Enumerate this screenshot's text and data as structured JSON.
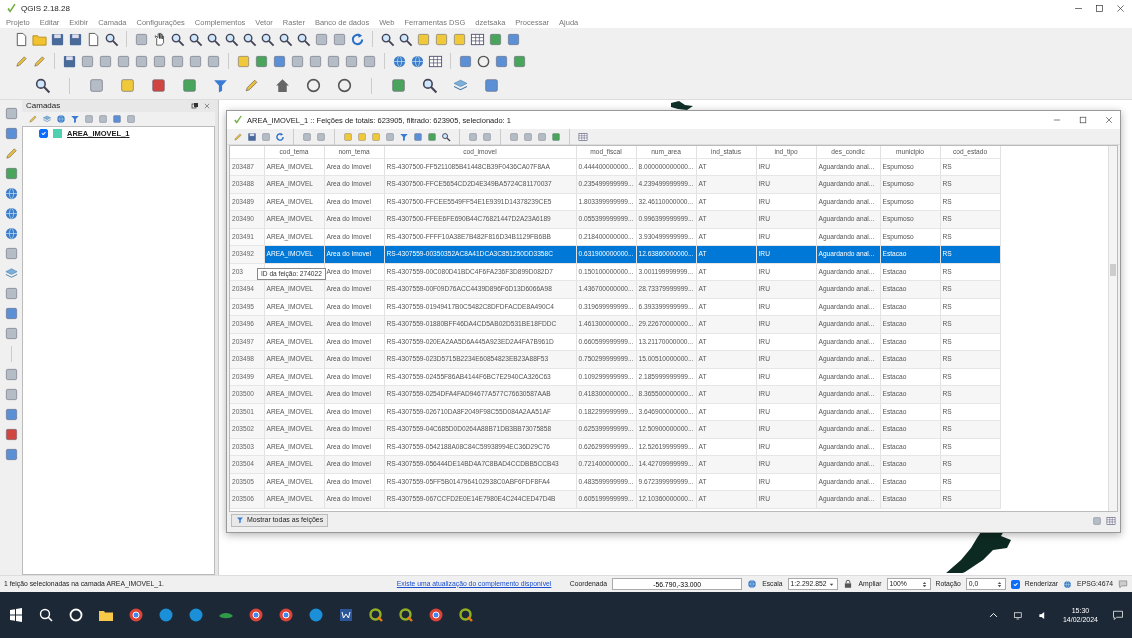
{
  "window": {
    "title": "QGIS 2.18.28"
  },
  "menu": [
    "Projeto",
    "Editar",
    "Exibir",
    "Camada",
    "Configurações",
    "Complementos",
    "Vetor",
    "Raster",
    "Banco de dados",
    "Web",
    "Ferramentas DSG",
    "dzetsaka",
    "Processar",
    "Ajuda"
  ],
  "layers_panel": {
    "title": "Camadas",
    "layers": [
      {
        "name": "AREA_IMOVEL_1",
        "checked": true
      }
    ]
  },
  "attribute_table": {
    "title": "AREA_IMOVEL_1 :: Feições de totais: 623905, filtrado: 623905, selecionado: 1",
    "columns": [
      "cod_tema",
      "nom_tema",
      "cod_imovel",
      "mod_fiscal",
      "num_area",
      "ind_status",
      "ind_tipo",
      "des_condic",
      "municipio",
      "cod_estado"
    ],
    "rows": [
      {
        "id": "203487",
        "selected": false,
        "cells": [
          "AREA_IMOVEL",
          "Area do Imovel",
          "RS-4307500-FF5211085B41448CB39F0436CA07F8AA",
          "0.444400000000...",
          "8.000000000000...",
          "AT",
          "IRU",
          "Aguardando anal...",
          "Espumoso",
          "RS"
        ]
      },
      {
        "id": "203488",
        "selected": false,
        "cells": [
          "AREA_IMOVEL",
          "Area do Imovel",
          "RS-4307500-FFCE5654CD2D4E349BA5724C81170037",
          "0.235499999999...",
          "4.239499999999...",
          "AT",
          "IRU",
          "Aguardando anal...",
          "Espumoso",
          "RS"
        ]
      },
      {
        "id": "203489",
        "selected": false,
        "cells": [
          "AREA_IMOVEL",
          "Area do Imovel",
          "RS-4307500-FFCEE5549FF54E1E9391D14378239CE5",
          "1.803399999999...",
          "32.46110000000...",
          "AT",
          "IRU",
          "Aguardando anal...",
          "Espumoso",
          "RS"
        ]
      },
      {
        "id": "203490",
        "selected": false,
        "cells": [
          "AREA_IMOVEL",
          "Area do Imovel",
          "RS-4307500-FFEE6FE690B44C76821447D2A23A6189",
          "0.055399999999...",
          "0.996399999999...",
          "AT",
          "IRU",
          "Aguardando anal...",
          "Espumoso",
          "RS"
        ]
      },
      {
        "id": "203491",
        "selected": false,
        "cells": [
          "AREA_IMOVEL",
          "Area do Imovel",
          "RS-4307500-FFFF10A38E7B482F816D34B1129FB6BB",
          "0.218400000000...",
          "3.930499999999...",
          "AT",
          "IRU",
          "Aguardando anal...",
          "Espumoso",
          "RS"
        ]
      },
      {
        "id": "203492",
        "selected": true,
        "cells": [
          "AREA_IMOVEL",
          "Area do Imovel",
          "RS-4307559-00350352AC8A41DCA3C851250DD3358C",
          "0.631900000000...",
          "12.63860000000...",
          "AT",
          "IRU",
          "Aguardando anal...",
          "Estacao",
          "RS"
        ]
      },
      {
        "id": "203",
        "selected": false,
        "cells": [
          null,
          "Area do Imovel",
          "RS-4307559-00C080D41BDC4F6FA236F3D899D082D7",
          "0.150100000000...",
          "3.001199999999...",
          "AT",
          "IRU",
          "Aguardando anal...",
          "Estacao",
          "RS"
        ]
      },
      {
        "id": "203494",
        "selected": false,
        "cells": [
          "AREA_IMOVEL",
          "Area do Imovel",
          "RS-4307559-00F09D76ACC4439D896F6D13D6066A98",
          "1.436700000000...",
          "28.73379999999...",
          "AT",
          "IRU",
          "Aguardando anal...",
          "Estacao",
          "RS"
        ]
      },
      {
        "id": "203495",
        "selected": false,
        "cells": [
          "AREA_IMOVEL",
          "Area do Imovel",
          "RS-4307559-01949417B0C5482C8DFDFACDE8A490C4",
          "0.319699999999...",
          "6.393399999999...",
          "AT",
          "IRU",
          "Aguardando anal...",
          "Estacao",
          "RS"
        ]
      },
      {
        "id": "203496",
        "selected": false,
        "cells": [
          "AREA_IMOVEL",
          "Area do Imovel",
          "RS-4307559-01880BFF46DA4CD5AB02D531BE18FDDC",
          "1.461300000000...",
          "29.22670000000...",
          "AT",
          "IRU",
          "Aguardando anal...",
          "Estacao",
          "RS"
        ]
      },
      {
        "id": "203497",
        "selected": false,
        "cells": [
          "AREA_IMOVEL",
          "Area do Imovel",
          "RS-4307559-020EA2AA5D6A445A923ED2A4FA7B961D",
          "0.660599999999...",
          "13.21170000000...",
          "AT",
          "IRU",
          "Aguardando anal...",
          "Estacao",
          "RS"
        ]
      },
      {
        "id": "203498",
        "selected": false,
        "cells": [
          "AREA_IMOVEL",
          "Area do Imovel",
          "RS-4307559-023D5715B2234E60854823EB23A88F53",
          "0.750299999999...",
          "15.00510000000...",
          "AT",
          "IRU",
          "Aguardando anal...",
          "Estacao",
          "RS"
        ]
      },
      {
        "id": "203499",
        "selected": false,
        "cells": [
          "AREA_IMOVEL",
          "Area do Imovel",
          "RS-4307559-02455F86AB4144F6BC7E2940CA326C63",
          "0.109299999999...",
          "2.185999999999...",
          "AT",
          "IRU",
          "Aguardando anal...",
          "Estacao",
          "RS"
        ]
      },
      {
        "id": "203500",
        "selected": false,
        "cells": [
          "AREA_IMOVEL",
          "Area do Imovel",
          "RS-4307559-0254DFA4FAD94677A577C76630587AAB",
          "0.418300000000...",
          "8.365500000000...",
          "AT",
          "IRU",
          "Aguardando anal...",
          "Estacao",
          "RS"
        ]
      },
      {
        "id": "203501",
        "selected": false,
        "cells": [
          "AREA_IMOVEL",
          "Area do Imovel",
          "RS-4307559-026710DA8F2049F98C55D084A2AA51AF",
          "0.182299999999...",
          "3.646900000000...",
          "AT",
          "IRU",
          "Aguardando anal...",
          "Estacao",
          "RS"
        ]
      },
      {
        "id": "203502",
        "selected": false,
        "cells": [
          "AREA_IMOVEL",
          "Area do Imovel",
          "RS-4307559-04C685D0D0264A88B71DB3BB73075858",
          "0.625399999999...",
          "12.50900000000...",
          "AT",
          "IRU",
          "Aguardando anal...",
          "Estacao",
          "RS"
        ]
      },
      {
        "id": "203503",
        "selected": false,
        "cells": [
          "AREA_IMOVEL",
          "Area do Imovel",
          "RS-4307559-0542188A08C84C59938994EC36D29C76",
          "0.626299999999...",
          "12.52619999999...",
          "AT",
          "IRU",
          "Aguardando anal...",
          "Estacao",
          "RS"
        ]
      },
      {
        "id": "203504",
        "selected": false,
        "cells": [
          "AREA_IMOVEL",
          "Area do Imovel",
          "RS-4307559-056444DE14BD4A7C8BAD4CCDBB5CCB43",
          "0.721400000000...",
          "14.42709999999...",
          "AT",
          "IRU",
          "Aguardando anal...",
          "Estacao",
          "RS"
        ]
      },
      {
        "id": "203505",
        "selected": false,
        "cells": [
          "AREA_IMOVEL",
          "Area do Imovel",
          "RS-4307559-05FF5B0147964102938C0ABF6FDF8FA4",
          "0.483599999999...",
          "9.672399999999...",
          "AT",
          "IRU",
          "Aguardando anal...",
          "Estacao",
          "RS"
        ]
      },
      {
        "id": "203506",
        "selected": false,
        "cells": [
          "AREA_IMOVEL",
          "Area do Imovel",
          "RS-4307559-067CCFD2E0E14E7980E4C244CED47D4B",
          "0.605199999999...",
          "12.10360000000...",
          "AT",
          "IRU",
          "Aguardando anal...",
          "Estacao",
          "RS"
        ]
      }
    ],
    "tooltip": "ID da feição: 274022",
    "filter_button": "Mostrar todas as feições"
  },
  "status_bar": {
    "message": "1 feição selecionadas na camada AREA_IMOVEL_1.",
    "update_link": "Existe uma atualização do complemento disponível",
    "coordinate_label": "Coordenada",
    "coordinate": "-56.790,-33.000",
    "scale_label": "Escala",
    "scale": "1:2.292.852",
    "zoom_label": "Ampliar",
    "zoom": "100%",
    "rotation_label": "Rotação",
    "rotation": "0,0",
    "render_label": "Renderizar",
    "render_checked": true,
    "crs": "EPSG:4674"
  },
  "taskbar": {
    "time": "15:30",
    "date": "14/02/2024"
  }
}
